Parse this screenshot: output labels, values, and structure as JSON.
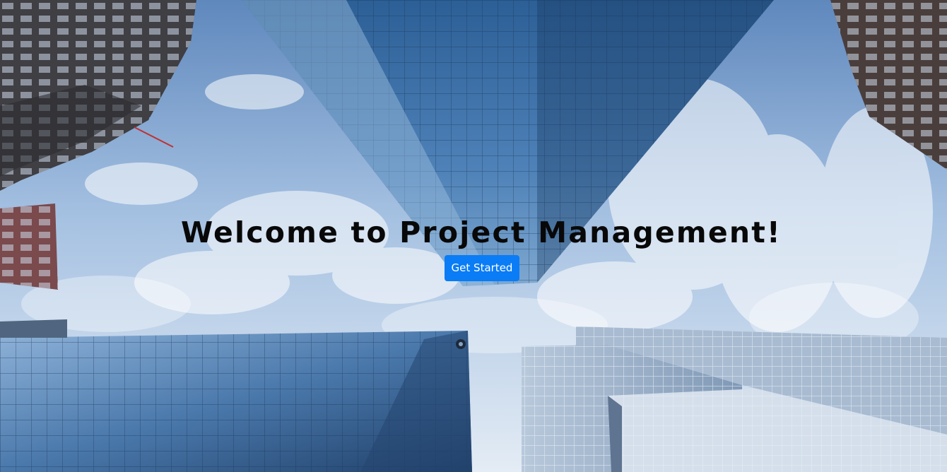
{
  "hero": {
    "title": "Welcome to Project Management!",
    "cta_label": "Get Started",
    "background_image": "low-angle-skyscrapers-sky",
    "accent_color": "#0a7cf6",
    "title_color": "#080808"
  }
}
